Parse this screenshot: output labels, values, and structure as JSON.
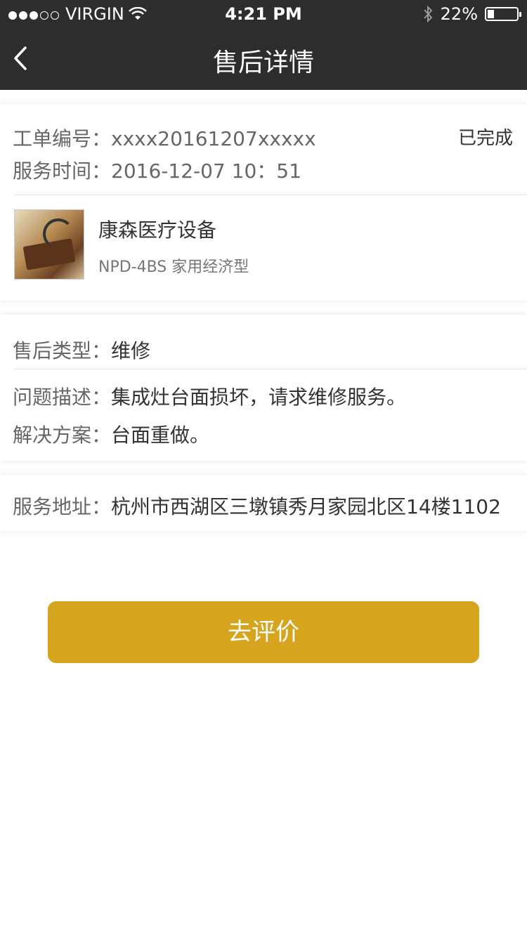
{
  "status_bar": {
    "carrier": "VIRGIN",
    "time": "4:21 PM",
    "battery": "22%",
    "battery_level": 0.22,
    "signal_bars": 3,
    "signal_total": 5
  },
  "nav": {
    "title": "售后详情",
    "back_icon": "chevron-left-icon"
  },
  "order": {
    "number_label": "工单编号：",
    "number_value": "xxxx20161207xxxxx",
    "status": "已完成",
    "time_label": "服务时间：",
    "time_value": "2016-12-07  10：51"
  },
  "product": {
    "name": "康森医疗设备",
    "model": "NPD-4BS 家用经济型"
  },
  "service": {
    "type_label": "售后类型：",
    "type_value": "维修",
    "desc_label": "问题描述：",
    "desc_value": "集成灶台面损坏，请求维修服务。",
    "solution_label": "解决方案：",
    "solution_value": "台面重做。"
  },
  "address": {
    "label": "服务地址：",
    "value": "杭州市西湖区三墩镇秀月家园北区14楼1102"
  },
  "action": {
    "evaluate_label": "去评价"
  },
  "colors": {
    "nav_bg": "#2d2d2d",
    "accent": "#d6a41d",
    "label_text": "#666666",
    "value_text": "#333333",
    "divider": "#e6e6e6"
  }
}
